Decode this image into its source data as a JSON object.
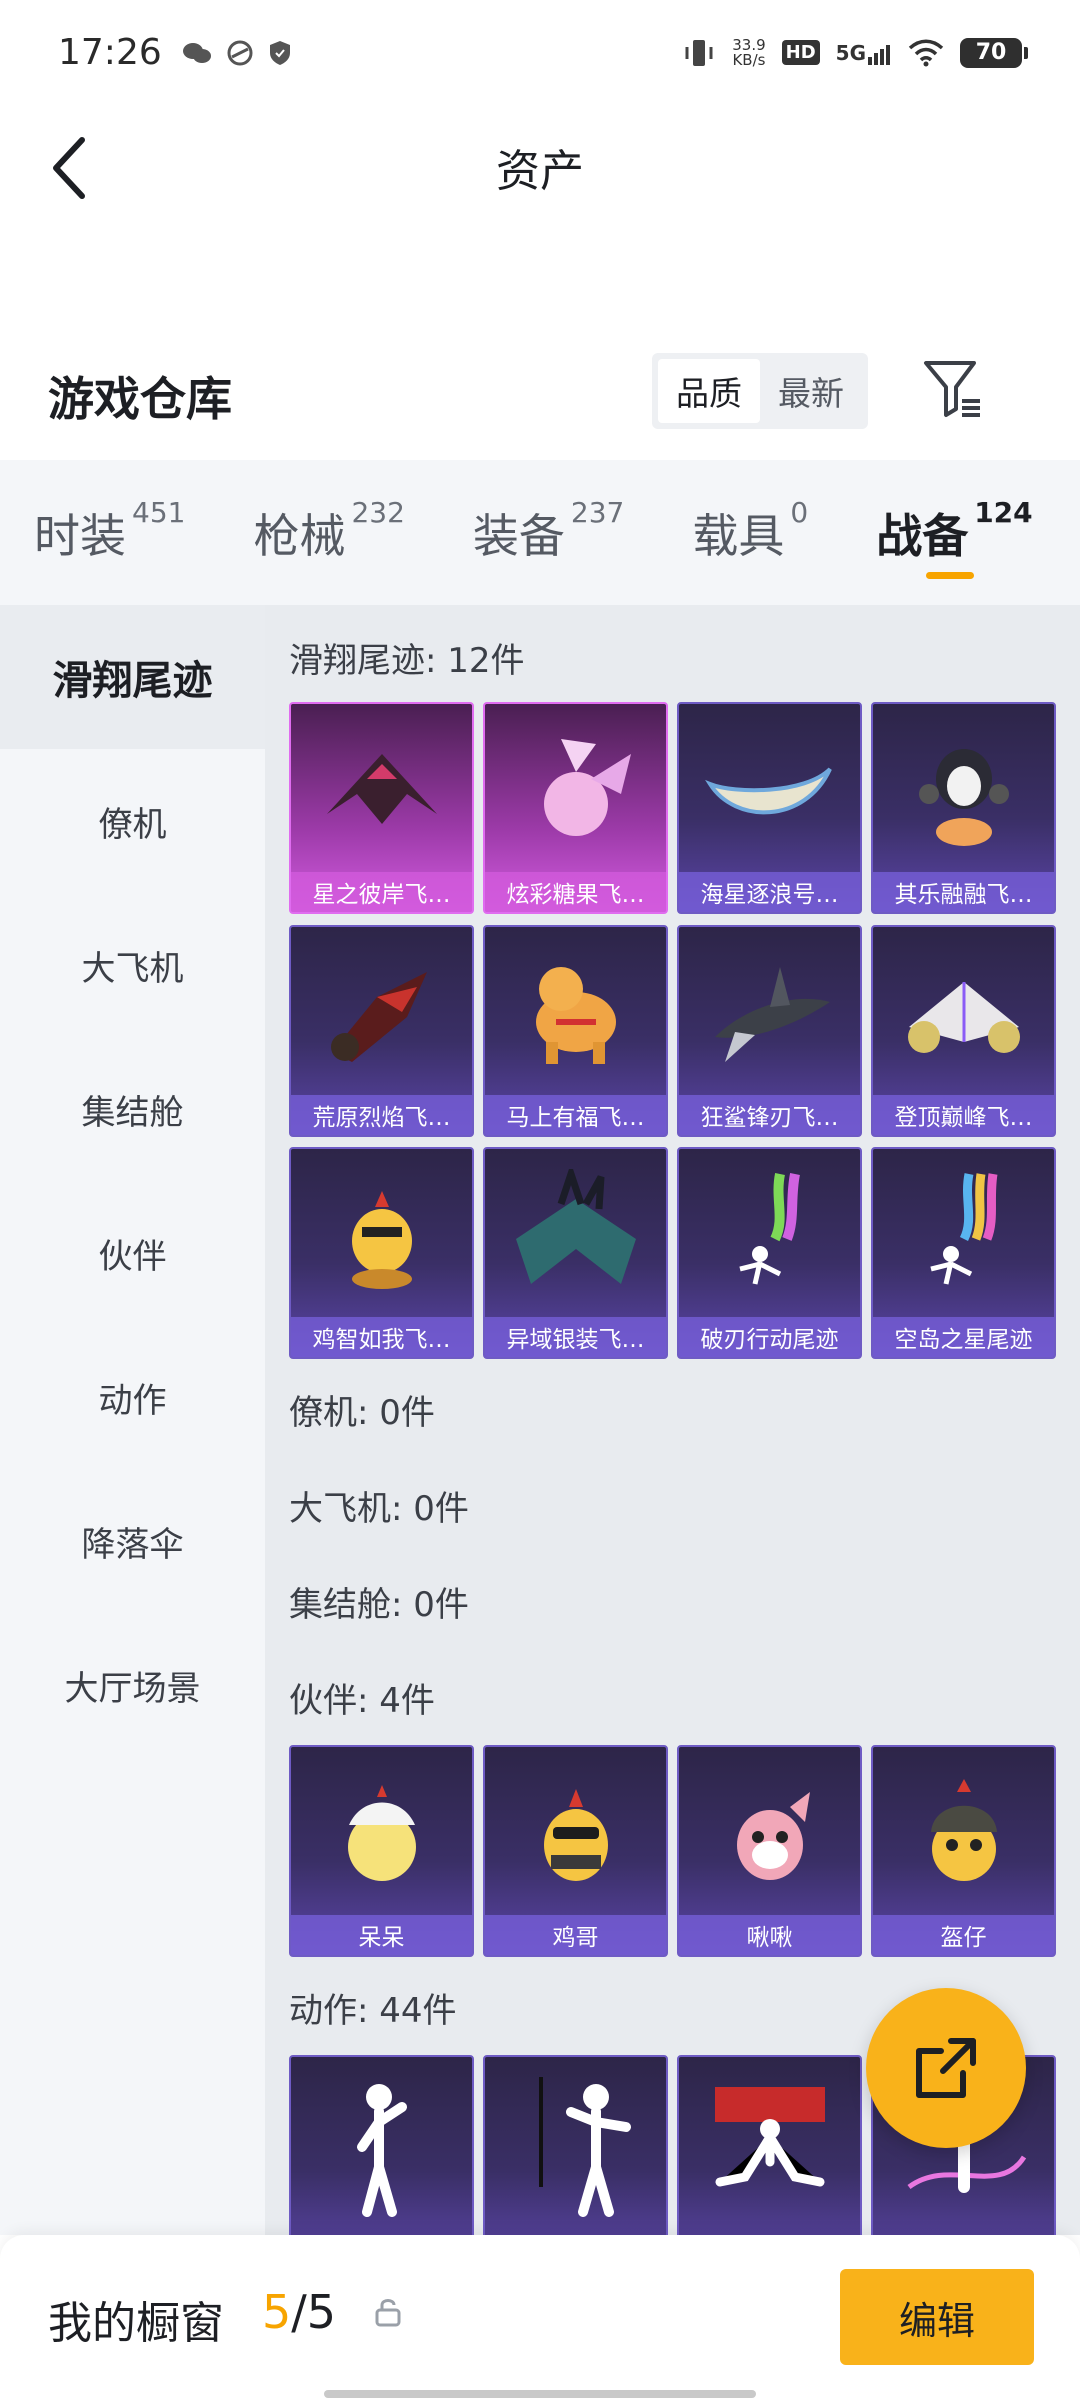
{
  "status_bar": {
    "time": "17:26",
    "net_speed_value": "33.9",
    "net_speed_unit": "KB/s",
    "hd": "HD",
    "network": "5G",
    "battery": "70"
  },
  "header": {
    "title": "资产"
  },
  "warehouse": {
    "title": "游戏仓库",
    "sort_options": [
      "品质",
      "最新"
    ],
    "active_sort": "品质"
  },
  "tabs": [
    {
      "label": "时装",
      "count": "451"
    },
    {
      "label": "枪械",
      "count": "232"
    },
    {
      "label": "装备",
      "count": "237"
    },
    {
      "label": "载具",
      "count": "0"
    },
    {
      "label": "战备",
      "count": "124"
    }
  ],
  "active_tab": "战备",
  "side_nav": [
    "滑翔尾迹",
    "僚机",
    "大飞机",
    "集结舱",
    "伙伴",
    "动作",
    "降落伞",
    "大厅场景"
  ],
  "active_side": "滑翔尾迹",
  "sections": {
    "trail": {
      "title": "滑翔尾迹: 12件",
      "items": [
        "星之彼岸飞…",
        "炫彩糖果飞…",
        "海星逐浪号…",
        "其乐融融飞…",
        "荒原烈焰飞…",
        "马上有福飞…",
        "狂鲨锋刃飞…",
        "登顶巅峰飞…",
        "鸡智如我飞…",
        "异域银装飞…",
        "破刃行动尾迹",
        "空岛之星尾迹"
      ]
    },
    "wingman": {
      "title": "僚机: 0件"
    },
    "plane": {
      "title": "大飞机: 0件"
    },
    "pod": {
      "title": "集结舱: 0件"
    },
    "partner": {
      "title": "伙伴: 4件",
      "items": [
        "呆呆",
        "鸡哥",
        "啾啾",
        "盔仔"
      ]
    },
    "emote": {
      "title": "动作: 44件"
    }
  },
  "bottom_bar": {
    "label": "我的橱窗",
    "count_used": "5",
    "count_sep": "/",
    "count_total": "5",
    "edit_label": "编辑"
  },
  "colors": {
    "accent": "#f9b21a",
    "card_purple": "#3a2f66",
    "card_pink": "#9c3aa8"
  }
}
